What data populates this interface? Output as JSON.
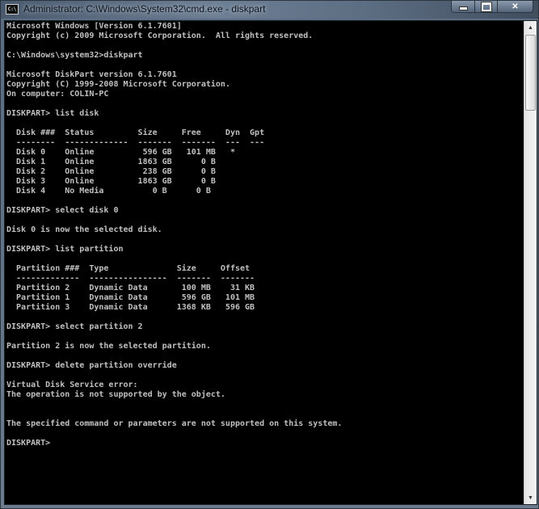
{
  "window": {
    "title": "Administrator: C:\\Windows\\System32\\cmd.exe - diskpart",
    "icon_label": "C:\\",
    "buttons": {
      "minimize": "minimize",
      "maximize": "maximize",
      "close": "✕"
    }
  },
  "console": {
    "lines": [
      "Microsoft Windows [Version 6.1.7601]",
      "Copyright (c) 2009 Microsoft Corporation.  All rights reserved.",
      "",
      "C:\\Windows\\system32>diskpart",
      "",
      "Microsoft DiskPart version 6.1.7601",
      "Copyright (C) 1999-2008 Microsoft Corporation.",
      "On computer: COLIN-PC",
      "",
      "DISKPART> list disk",
      "",
      "  Disk ###  Status         Size     Free     Dyn  Gpt",
      "  --------  -------------  -------  -------  ---  ---",
      "  Disk 0    Online          596 GB   101 MB   *",
      "  Disk 1    Online         1863 GB      0 B",
      "  Disk 2    Online          238 GB      0 B",
      "  Disk 3    Online         1863 GB      0 B",
      "  Disk 4    No Media          0 B      0 B",
      "",
      "DISKPART> select disk 0",
      "",
      "Disk 0 is now the selected disk.",
      "",
      "DISKPART> list partition",
      "",
      "  Partition ###  Type              Size     Offset",
      "  -------------  ----------------  -------  -------",
      "  Partition 2    Dynamic Data       100 MB    31 KB",
      "  Partition 1    Dynamic Data       596 GB   101 MB",
      "  Partition 3    Dynamic Data      1368 KB   596 GB",
      "",
      "DISKPART> select partition 2",
      "",
      "Partition 2 is now the selected partition.",
      "",
      "DISKPART> delete partition override",
      "",
      "Virtual Disk Service error:",
      "The operation is not supported by the object.",
      "",
      "",
      "The specified command or parameters are not supported on this system.",
      "",
      "DISKPART> "
    ]
  },
  "scrollbar": {
    "up_arrow": "▲",
    "down_arrow": "▼"
  }
}
